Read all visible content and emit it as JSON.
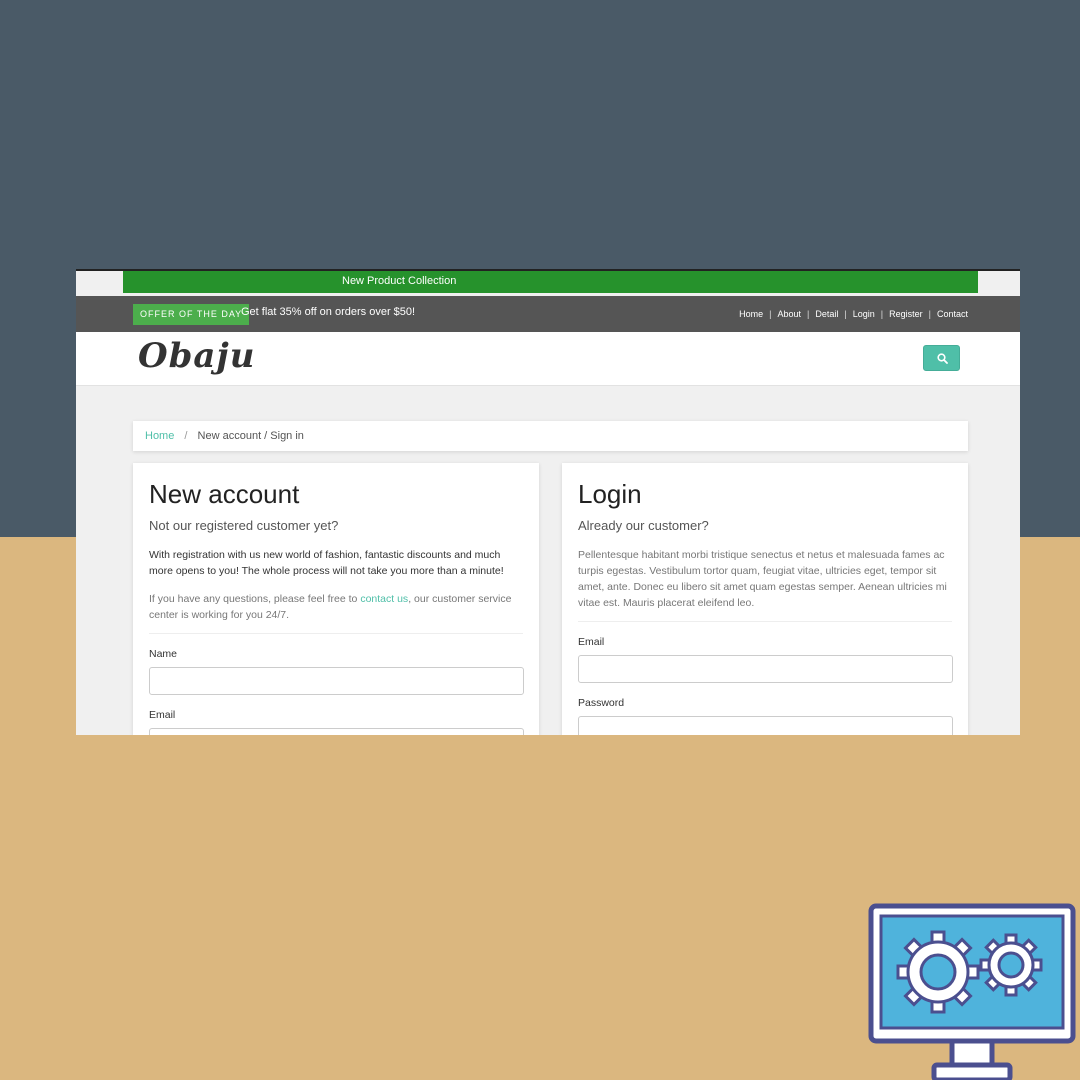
{
  "promo_bar": {
    "text": "New Product Collection"
  },
  "topbar": {
    "offer_badge": "OFFER OF THE DAY",
    "offer_text": "Get flat 35% off on orders over $50!",
    "links": [
      "Home",
      "About",
      "Detail",
      "Login",
      "Register",
      "Contact"
    ]
  },
  "navbar": {
    "logo": "Obaju"
  },
  "breadcrumb": {
    "home": "Home",
    "separator": "/",
    "current": "New account / Sign in"
  },
  "new_account": {
    "title": "New account",
    "lead": "Not our registered customer yet?",
    "body": "With registration with us new world of fashion, fantastic discounts and much more opens to you! The whole process will not take you more than a minute!",
    "help_before": "If you have any questions, please feel free to ",
    "help_link": "contact us",
    "help_after": ", our customer service center is working for you 24/7.",
    "name_label": "Name",
    "name_value": "",
    "email_label": "Email",
    "email_value": ""
  },
  "login": {
    "title": "Login",
    "lead": "Already our customer?",
    "body": "Pellentesque habitant morbi tristique senectus et netus et malesuada fames ac turpis egestas. Vestibulum tortor quam, feugiat vitae, ultricies eget, tempor sit amet, ante. Donec eu libero sit amet quam egestas semper. Aenean ultricies mi vitae est. Mauris placerat eleifend leo.",
    "email_label": "Email",
    "email_value": "",
    "password_label": "Password",
    "password_value": ""
  },
  "icons": {
    "search": "search-icon",
    "monitor": "monitor-gears-icon"
  },
  "colors": {
    "accent": "#4fbfa8",
    "promo_green": "#26922c",
    "topbar": "#555555",
    "background_top": "#4a5a67",
    "background_bottom": "#dbb77f"
  }
}
